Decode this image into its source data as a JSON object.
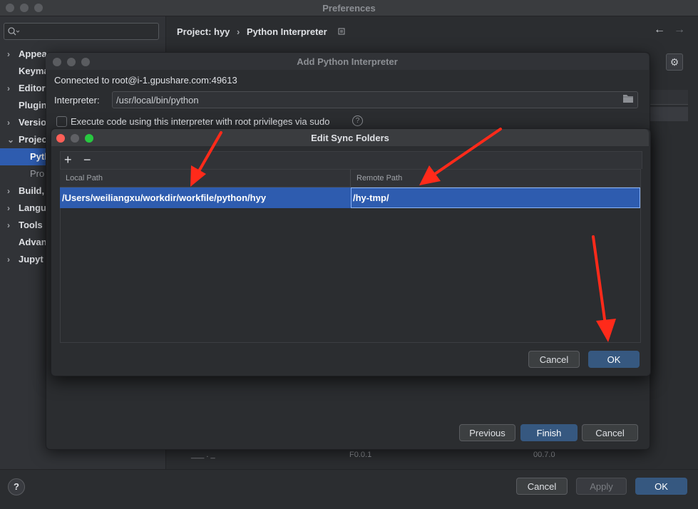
{
  "preferences": {
    "title": "Preferences",
    "search_placeholder": "",
    "breadcrumb": {
      "project": "Project: hyy",
      "separator": "›",
      "page": "Python Interpreter"
    },
    "sidebar": [
      {
        "label": "Appea",
        "chevron": "›"
      },
      {
        "label": "Keyma",
        "chevron": ""
      },
      {
        "label": "Editor",
        "chevron": "›"
      },
      {
        "label": "Plugin",
        "chevron": ""
      },
      {
        "label": "Versio",
        "chevron": "›"
      },
      {
        "label": "Projec",
        "chevron": "⌄"
      },
      {
        "label": "Pyth",
        "chevron": ""
      },
      {
        "label": "Pro",
        "chevron": ""
      },
      {
        "label": "Build,",
        "chevron": "›"
      },
      {
        "label": "Langu",
        "chevron": "›"
      },
      {
        "label": "Tools",
        "chevron": "›"
      },
      {
        "label": "Advan",
        "chevron": ""
      },
      {
        "label": "Jupyt",
        "chevron": "›"
      }
    ],
    "background_row": {
      "a": "___ . _",
      "b": "F0.0.1",
      "c": "00.7.0"
    },
    "footer": {
      "help": "?",
      "cancel": "Cancel",
      "apply": "Apply",
      "ok": "OK"
    }
  },
  "add_interpreter": {
    "title": "Add Python Interpreter",
    "connected": "Connected to root@i-1.gpushare.com:49613",
    "interpreter_label": "Interpreter:",
    "interpreter_value": "/usr/local/bin/python",
    "sudo_label": "Execute code using this interpreter with root privileges via sudo",
    "sudo_help": "?",
    "buttons": {
      "previous": "Previous",
      "finish": "Finish",
      "cancel": "Cancel"
    }
  },
  "sync_folders": {
    "title": "Edit Sync Folders",
    "toolbar": {
      "add": "+",
      "remove": "−"
    },
    "columns": {
      "local": "Local Path",
      "remote": "Remote Path"
    },
    "rows": [
      {
        "local": "/Users/weiliangxu/workdir/workfile/python/hyy",
        "remote": "/hy-tmp/"
      }
    ],
    "buttons": {
      "cancel": "Cancel",
      "ok": "OK"
    }
  },
  "colors": {
    "accent": "#2e5caf",
    "primary_button": "#365880",
    "annotation_arrow": "#ff2a1a"
  },
  "icons": [
    "search-icon",
    "chevron-right-icon",
    "back-arrow-icon",
    "forward-arrow-icon",
    "gear-icon",
    "folder-icon",
    "help-icon"
  ]
}
